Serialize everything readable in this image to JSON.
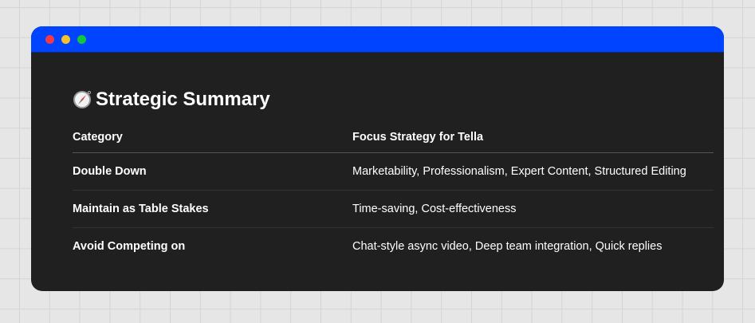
{
  "window": {
    "controls": [
      "close",
      "minimize",
      "maximize"
    ]
  },
  "title": "Strategic Summary",
  "title_icon": "compass-icon",
  "table": {
    "headers": [
      "Category",
      "Focus Strategy for Tella"
    ],
    "rows": [
      {
        "category": "Double Down",
        "strategy": "Marketability, Professionalism, Expert Content, Structured Editing"
      },
      {
        "category": "Maintain as Table Stakes",
        "strategy": "Time-saving, Cost-effectiveness"
      },
      {
        "category": "Avoid Competing on",
        "strategy": "Chat-style async video, Deep team integration, Quick replies"
      }
    ]
  },
  "colors": {
    "titlebar": "#0044ff",
    "panel": "#202020"
  }
}
